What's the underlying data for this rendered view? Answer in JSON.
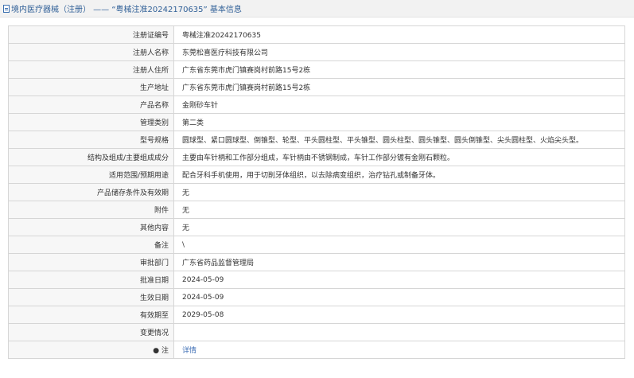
{
  "header": {
    "prefix": "境内医疗器械（注册）",
    "separator": " —— ",
    "record_title": "“粤械注准20242170635”",
    "suffix": " 基本信息"
  },
  "rows": [
    {
      "label": "注册证编号",
      "value": "粤械注准20242170635"
    },
    {
      "label": "注册人名称",
      "value": "东莞松喜医疗科技有限公司"
    },
    {
      "label": "注册人住所",
      "value": "广东省东莞市虎门镇赛岗村前路15号2栋"
    },
    {
      "label": "生产地址",
      "value": "广东省东莞市虎门镇赛岗村前路15号2栋"
    },
    {
      "label": "产品名称",
      "value": "金刚砂车针"
    },
    {
      "label": "管理类别",
      "value": "第二类"
    },
    {
      "label": "型号规格",
      "value": "圆球型、紧口圆球型、倒锥型、轮型、平头圆柱型、平头锥型、圆头柱型、圆头锥型、圆头倒锥型、尖头圆柱型、火焰尖头型。"
    },
    {
      "label": "结构及组成/主要组成成分",
      "value": "主要由车针柄和工作部分组成，车针柄由不锈钢制成，车针工作部分镀有金刚石颗粒。"
    },
    {
      "label": "适用范围/预期用途",
      "value": "配合牙科手机使用，用于切削牙体组织，以去除病变组织，治疗钻孔或制备牙体。"
    },
    {
      "label": "产品储存条件及有效期",
      "value": "无"
    },
    {
      "label": "附件",
      "value": "无"
    },
    {
      "label": "其他内容",
      "value": "无"
    },
    {
      "label": "备注",
      "value": "\\"
    },
    {
      "label": "审批部门",
      "value": "广东省药品监督管理局"
    },
    {
      "label": "批准日期",
      "value": "2024-05-09"
    },
    {
      "label": "生效日期",
      "value": "2024-05-09"
    },
    {
      "label": "有效期至",
      "value": "2029-05-08"
    },
    {
      "label": "变更情况",
      "value": ""
    },
    {
      "label": "● 注",
      "value": "详情"
    }
  ]
}
